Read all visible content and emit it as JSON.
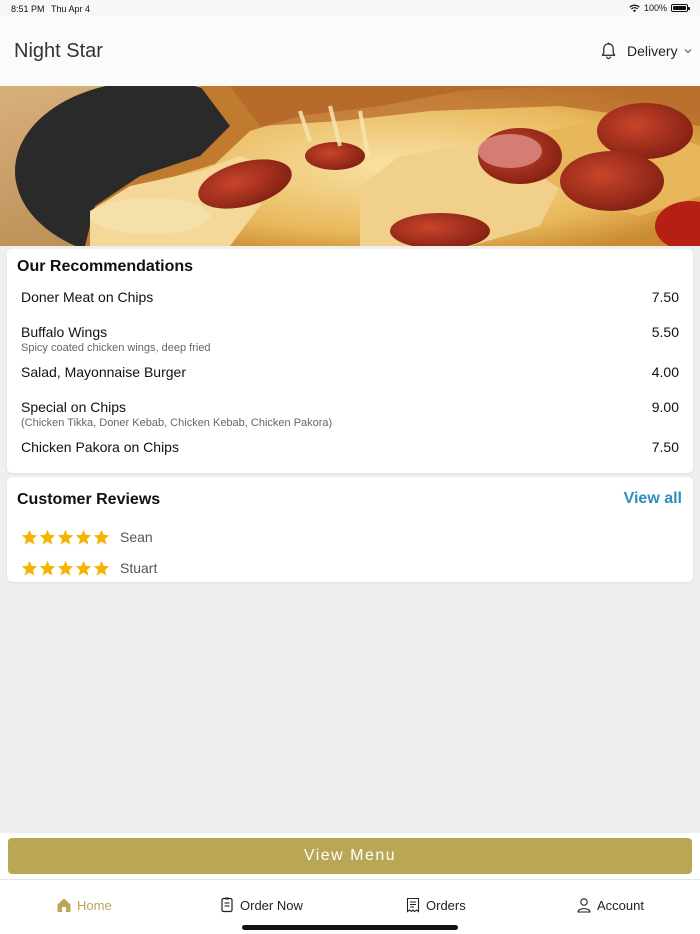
{
  "status_bar": {
    "time": "8:51 PM",
    "date": "Thu Apr 4",
    "battery": "100%"
  },
  "header": {
    "title": "Night Star",
    "mode": "Delivery"
  },
  "recommendations": {
    "title": "Our Recommendations",
    "items": [
      {
        "name": "Doner Meat on Chips",
        "description": "",
        "price": "7.50"
      },
      {
        "name": "Buffalo Wings",
        "description": "Spicy coated chicken wings, deep fried",
        "price": "5.50"
      },
      {
        "name": "Salad, Mayonnaise Burger",
        "description": "",
        "price": "4.00"
      },
      {
        "name": "Special on Chips",
        "description": "(Chicken Tikka, Doner Kebab, Chicken Kebab, Chicken Pakora)",
        "price": "9.00"
      },
      {
        "name": "Chicken Pakora on Chips",
        "description": "",
        "price": "7.50"
      }
    ]
  },
  "reviews": {
    "title": "Customer Reviews",
    "view_all": "View all",
    "items": [
      {
        "reviewer": "Sean",
        "rating": 5
      },
      {
        "reviewer": "Stuart",
        "rating": 5
      }
    ]
  },
  "view_menu_label": "View Menu",
  "tabs": [
    {
      "label": "Home",
      "icon": "home-icon",
      "active": true
    },
    {
      "label": "Order Now",
      "icon": "order-icon",
      "active": false
    },
    {
      "label": "Orders",
      "icon": "receipt-icon",
      "active": false
    },
    {
      "label": "Account",
      "icon": "user-icon",
      "active": false
    }
  ],
  "colors": {
    "accent": "#b9a756",
    "link": "#2b8fb9",
    "star": "#f5b400",
    "background": "#efefef"
  }
}
